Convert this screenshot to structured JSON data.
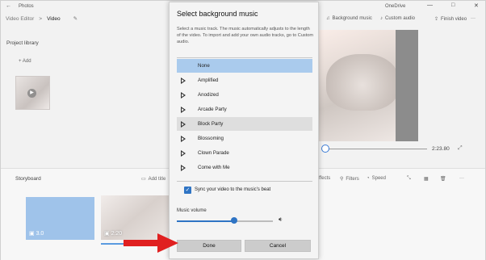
{
  "window": {
    "app_title": "Photos",
    "onedrive_label": "OneDrive",
    "back_glyph": "←",
    "minimize_glyph": "—",
    "maximize_glyph": "□",
    "close_glyph": "✕"
  },
  "breadcrumb": {
    "parent": "Video Editor",
    "separator": ">",
    "current": "Video",
    "edit_glyph": "✎"
  },
  "toolbar": {
    "background_music": "Background music",
    "custom_audio": "Custom audio",
    "finish_video": "Finish video",
    "more_glyph": "···"
  },
  "project_library": {
    "title": "Project library",
    "add_label": "Add",
    "add_glyph": "+"
  },
  "preview": {
    "timecode": "2:23.80",
    "progress_fraction": 0.0
  },
  "storyboard": {
    "title": "Storyboard",
    "add_title_card": "Add title",
    "effects": "ffects",
    "filters": "Filters",
    "speed": "Speed",
    "clips": [
      {
        "duration": "3.0"
      },
      {
        "duration": "2:20"
      }
    ]
  },
  "dialog": {
    "title": "Select background music",
    "description": "Select a music track. The music automatically adjusts to the length of the video. To import and add your own audio tracks, go to Custom audio.",
    "tracks": [
      {
        "name": "None",
        "state": "selected"
      },
      {
        "name": "Amplified",
        "state": ""
      },
      {
        "name": "Anodized",
        "state": ""
      },
      {
        "name": "Arcade Party",
        "state": ""
      },
      {
        "name": "Block Party",
        "state": "hover"
      },
      {
        "name": "Blossoming",
        "state": ""
      },
      {
        "name": "Clown Parade",
        "state": ""
      },
      {
        "name": "Come with Me",
        "state": ""
      }
    ],
    "sync_label": "Sync your video to the music's beat",
    "sync_checked": true,
    "volume_label": "Music volume",
    "volume_level": 0.6,
    "volume_glyph": "🔉",
    "done_label": "Done",
    "cancel_label": "Cancel"
  },
  "colors": {
    "accent": "#2f74c4",
    "selected_row": "#aacbed",
    "annotation_arrow": "#e02020"
  }
}
